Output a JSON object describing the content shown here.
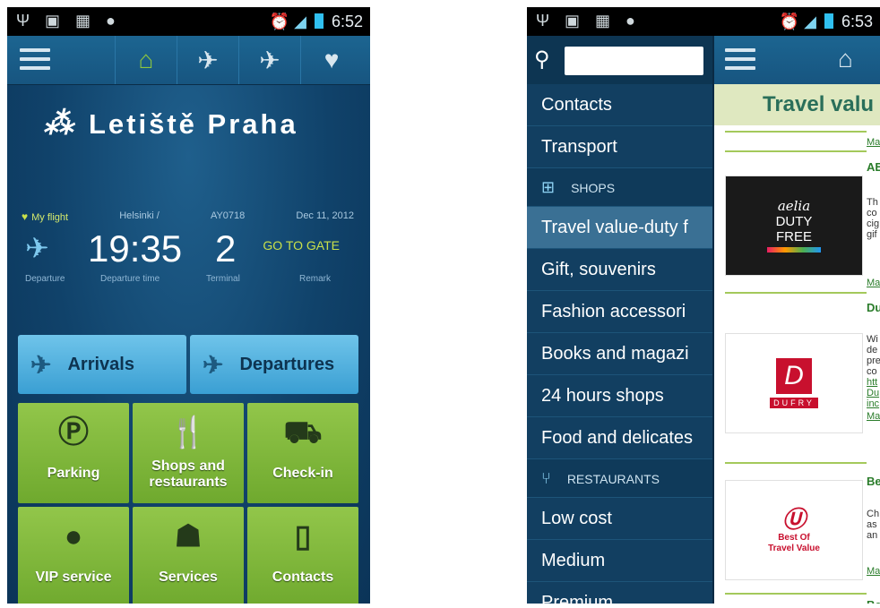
{
  "left_phone": {
    "status": {
      "time": "6:52"
    },
    "logo_text": "Letiště Praha",
    "flight": {
      "my_flight_label": "My flight",
      "destination": "Helsinki /",
      "flight_no": "AY0718",
      "date": "Dec 11, 2012",
      "departure_time": "19:35",
      "terminal": "2",
      "remark": "GO TO GATE",
      "labels": {
        "departure": "Departure",
        "departure_time": "Departure time",
        "terminal": "Terminal",
        "remark": "Remark"
      }
    },
    "tabs": {
      "arrivals": "Arrivals",
      "departures": "Departures"
    },
    "tiles": [
      {
        "label": "Parking"
      },
      {
        "label": "Shops and restaurants"
      },
      {
        "label": "Check-in"
      },
      {
        "label": "VIP service"
      },
      {
        "label": "Services"
      },
      {
        "label": "Contacts"
      }
    ]
  },
  "right_phone": {
    "status": {
      "time": "6:53"
    },
    "search_placeholder": "",
    "drawer": {
      "items_top": [
        "Contacts",
        "Transport"
      ],
      "shops_header": "SHOPS",
      "shop_items": [
        "Travel value-duty f",
        "Gift, souvenirs",
        "Fashion accessori",
        "Books and magazi",
        "24 hours shops",
        "Food and delicates"
      ],
      "restaurants_header": "RESTAURANTS",
      "restaurant_items": [
        "Low cost",
        "Medium",
        "Premium"
      ]
    },
    "content": {
      "title": "Travel valu",
      "more_link": "Ma",
      "shops": [
        {
          "name": "AE",
          "desc": "Th\nco\ncig\ngif",
          "more": "Ma",
          "logo_lines": [
            "aelia",
            "DUTY",
            "FREE"
          ]
        },
        {
          "name": "Du",
          "desc": "Wi\nde\npre\nco",
          "links": [
            "htt",
            "Du",
            "inc"
          ],
          "more": "Ma",
          "logo_text": "DUFRY"
        },
        {
          "name": "Be",
          "desc": "Ch\nas\nan",
          "more": "Ma",
          "logo_lines": [
            "Best Of",
            "Travel Value"
          ]
        },
        {
          "name": "Be"
        }
      ]
    }
  }
}
